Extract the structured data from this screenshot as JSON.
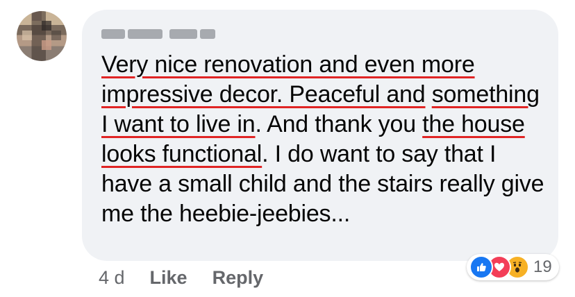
{
  "comment": {
    "segments": [
      {
        "text": "Very nice renovation and even more",
        "underlined": true
      },
      {
        "text": "impressive decor. Peaceful and",
        "underlined": true
      },
      {
        "text": "something I want to live in",
        "underlined": true
      },
      {
        "text": ". And thank you ",
        "underlined": false
      },
      {
        "text": "the house looks functional",
        "underlined": true
      },
      {
        "text": ". I do want to say that I have a small child and the stairs really give me the heebie-jeebies...",
        "underlined": false
      }
    ]
  },
  "meta": {
    "time": "4 d",
    "like_label": "Like",
    "reply_label": "Reply"
  },
  "reactions": {
    "icons": [
      "like-icon",
      "love-icon",
      "wow-icon"
    ],
    "count": "19"
  },
  "colors": {
    "bubble": "#f0f2f5",
    "underline": "#e02424",
    "like": "#1877f2",
    "love": "#f33e58",
    "wow": "#f7b125",
    "meta_text": "#65676b"
  }
}
